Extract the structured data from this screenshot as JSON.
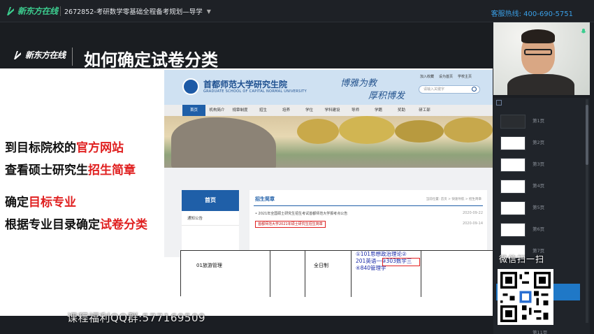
{
  "app": {
    "logo_text": "新东方在线",
    "course_title": "2672852-考研数学零基础全程备考规划—导学",
    "hotline": "客服热线: 400-690-5751"
  },
  "slide": {
    "logo_text": "新东方在线",
    "title": "如何确定试卷分类",
    "bullets": [
      {
        "normal": "到目标院校的",
        "highlight": "官方网站"
      },
      {
        "normal": "查看硕士研究生",
        "highlight": "招生简章"
      },
      {
        "normal": "确定",
        "highlight": "目标专业"
      },
      {
        "normal": "根据专业目录确定",
        "highlight": "试卷分类"
      }
    ]
  },
  "website": {
    "name_cn": "首都师范大学研究生院",
    "name_en": "GRADUATE SCHOOL OF CAPITAL NORMAL UNIVERSITY",
    "motto_1": "博雅为教",
    "motto_2": "厚积博发",
    "top_links": [
      "加入收藏",
      "设为首页",
      "学校主页"
    ],
    "search_placeholder": "请输入关键字",
    "nav": [
      "首页",
      "机构简介",
      "规章制度",
      "招生",
      "培养",
      "学位",
      "学科建设",
      "导师",
      "学籍",
      "奖助",
      "研工部"
    ],
    "side_title": "首页",
    "side_items": [
      "通知公告"
    ],
    "section_title": "招生简章",
    "breadcrumb": "当前位置: 首页 > 快速导航 > 招生简章",
    "news": [
      {
        "text": "• 2021年全国硕士研究生招生考试首都师范大学报考点公告",
        "date": "2020-09-22"
      },
      {
        "text": "首都师范大学2021年硕士研究生招生简章",
        "date": "2020-09-14"
      }
    ]
  },
  "table": {
    "direction": "01旅游管理",
    "mode": "全日制",
    "subjects": [
      "①101思想政治理论②",
      "201英语一",
      "③303数学三",
      "④840管理学"
    ]
  },
  "watermark_qq": "课程福利QQ群:577169509",
  "thumbnails": [
    "第1页",
    "第2页",
    "第3页",
    "第4页",
    "第5页",
    "第6页",
    "第7页",
    "第11页"
  ],
  "qr_caption": "微信扫一扫",
  "colors": {
    "accent_green": "#3ccd8f",
    "highlight_red": "#e02020",
    "hotline_blue": "#3aa0e8",
    "selected_blue": "#1f78c7"
  }
}
